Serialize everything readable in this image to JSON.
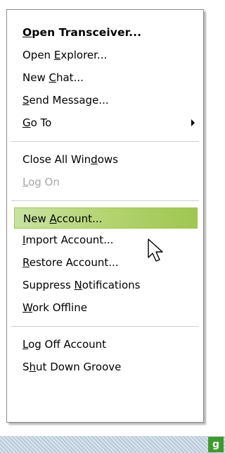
{
  "menu": {
    "open_transceiver": {
      "pre": "",
      "u": "O",
      "post": "pen Transceiver..."
    },
    "open_explorer": {
      "pre": "Open ",
      "u": "E",
      "post": "xplorer..."
    },
    "new_chat": {
      "pre": "New ",
      "u": "C",
      "post": "hat..."
    },
    "send_message": {
      "pre": "",
      "u": "S",
      "post": "end Message..."
    },
    "go_to": {
      "pre": "",
      "u": "G",
      "post": "o To"
    },
    "close_all_windows": {
      "pre": "Close All Win",
      "u": "d",
      "post": "ows"
    },
    "log_on": {
      "pre": "",
      "u": "L",
      "post": "og On"
    },
    "new_account": {
      "pre": "New ",
      "u": "A",
      "post": "ccount..."
    },
    "import_account": {
      "pre": "",
      "u": "I",
      "post": "mport Account..."
    },
    "restore_account": {
      "pre": "",
      "u": "R",
      "post": "estore Account..."
    },
    "suppress_notifications": {
      "pre": "Suppress ",
      "u": "N",
      "post": "otifications"
    },
    "work_offline": {
      "pre": "",
      "u": "W",
      "post": "ork Offline"
    },
    "log_off_account": {
      "pre": "",
      "u": "L",
      "post": "og Off Account"
    },
    "shut_down_groove": {
      "pre": "S",
      "u": "h",
      "post": "ut Down Groove"
    }
  },
  "taskbar": {
    "tray_badge": "g"
  },
  "colors": {
    "highlight": "#b2d26e",
    "disabled_text": "#a7a7a7",
    "tray_green": "#3f9a2e"
  },
  "icons": {
    "submenu": "submenu-arrow-icon",
    "cursor": "mouse-pointer-icon",
    "tray": "groove-tray-icon"
  }
}
